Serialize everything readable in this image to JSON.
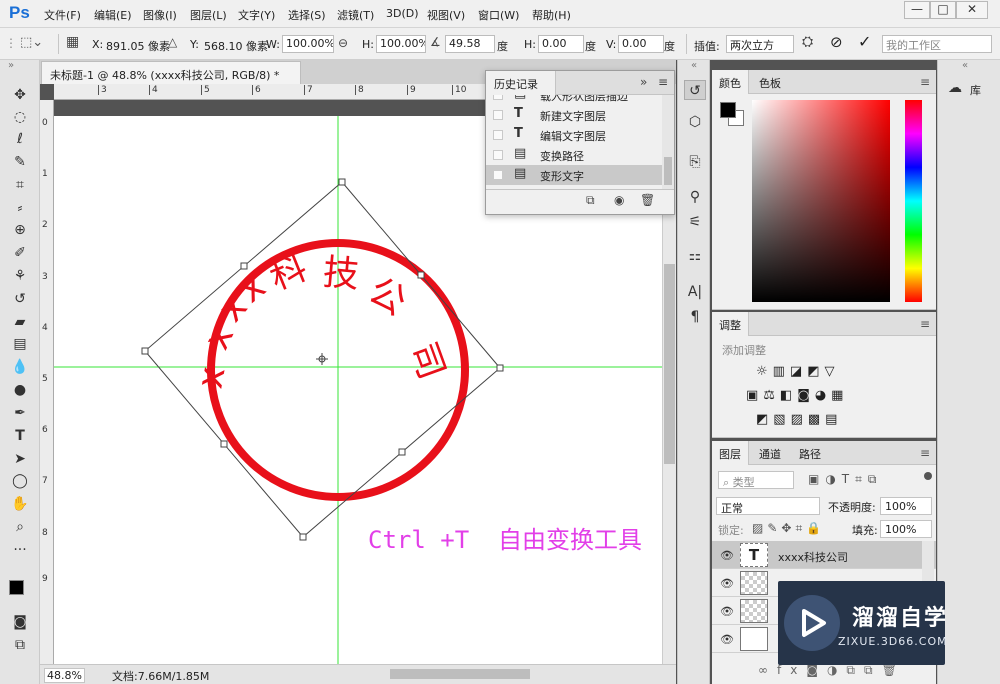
{
  "app": {
    "logo": "Ps"
  },
  "menu": [
    "文件(F)",
    "编辑(E)",
    "图像(I)",
    "图层(L)",
    "文字(Y)",
    "选择(S)",
    "滤镜(T)",
    "3D(D)",
    "视图(V)",
    "窗口(W)",
    "帮助(H)"
  ],
  "window_controls": {
    "minimize": "—",
    "maximize": "□",
    "close": "✕"
  },
  "options": {
    "x_label": "X:",
    "x_value": "891.05 像素",
    "y_label": "Y:",
    "y_value": "568.10 像素",
    "w_label": "W:",
    "w_value": "100.00%",
    "h_label": "H:",
    "h_value": "100.00%",
    "angle_value": "49.58",
    "angle_unit": "度",
    "hskew_label": "H:",
    "hskew_value": "0.00",
    "hskew_unit": "度",
    "vskew_label": "V:",
    "vskew_value": "0.00",
    "vskew_unit": "度",
    "interp_label": "插值:",
    "interp_value": "两次立方",
    "workspace": "我的工作区"
  },
  "document": {
    "tab_title": "未标题-1 @ 48.8% (xxxx科技公司, RGB/8) *",
    "ruler_top": [
      "3",
      "4",
      "5",
      "6",
      "7",
      "8",
      "9",
      "10"
    ],
    "ruler_left": [
      "0",
      "1",
      "2",
      "3",
      "4",
      "5",
      "6",
      "7",
      "8",
      "9"
    ],
    "zoom": "48.8%",
    "doc_info": "文档:7.66M/1.85M"
  },
  "canvas": {
    "stamp_text": "xxxx科技公司",
    "stamp_color": "#e8101a",
    "annotation": "Ctrl +T  自由变换工具",
    "annotation_color": "#e23fe8"
  },
  "history": {
    "tab": "历史记录",
    "items": [
      {
        "icon": "doc-icon",
        "label": "载入形状图层描边"
      },
      {
        "icon": "type-icon",
        "label": "新建文字图层"
      },
      {
        "icon": "type-icon",
        "label": "编辑文字图层"
      },
      {
        "icon": "doc-icon",
        "label": "变换路径"
      },
      {
        "icon": "doc-icon",
        "label": "变形文字"
      }
    ],
    "selected_index": 4
  },
  "color_panel": {
    "tabs": [
      "颜色",
      "色板"
    ],
    "fg": "#000000",
    "bg": "#ffffff"
  },
  "adjust_panel": {
    "tab": "调整",
    "hint": "添加调整"
  },
  "layers_panel": {
    "tabs": [
      "图层",
      "通道",
      "路径"
    ],
    "filter": "类型",
    "blend_mode": "正常",
    "opacity_label": "不透明度:",
    "opacity_value": "100%",
    "lock_label": "锁定:",
    "fill_label": "填充:",
    "fill_value": "100%",
    "layers": [
      {
        "name": "xxxx科技公司",
        "kind": "text",
        "selected": true
      },
      {
        "name": "",
        "kind": "shape",
        "selected": false
      },
      {
        "name": "",
        "kind": "shape",
        "selected": false
      },
      {
        "name": "",
        "kind": "background",
        "selected": false
      }
    ]
  },
  "library": {
    "label": "库"
  },
  "watermark": {
    "title": "溜溜自学",
    "subtitle": "ZIXUE.3D66.COM"
  }
}
